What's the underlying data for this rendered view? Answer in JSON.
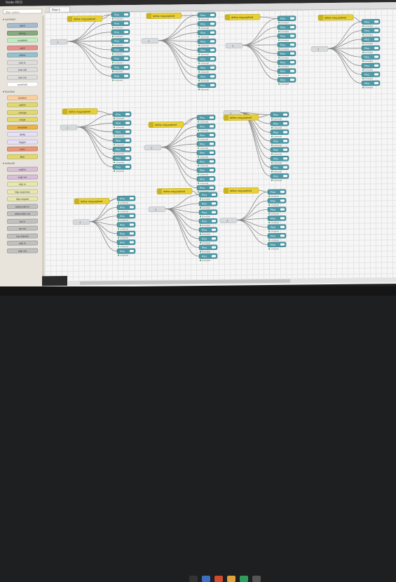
{
  "window": {
    "title": "Node-RED"
  },
  "palette": {
    "search_placeholder": "filter nodes",
    "categories": [
      "common",
      "function",
      "network"
    ],
    "nodes": [
      {
        "label": "inject",
        "color": "#a6bbcf"
      },
      {
        "label": "debug",
        "color": "#87a980"
      },
      {
        "label": "complete",
        "color": "#c0edc0"
      },
      {
        "label": "catch",
        "color": "#e49191"
      },
      {
        "label": "status",
        "color": "#94c1d0"
      },
      {
        "label": "link in",
        "color": "#dddddd"
      },
      {
        "label": "link call",
        "color": "#dddddd"
      },
      {
        "label": "link out",
        "color": "#dddddd"
      },
      {
        "label": "comment",
        "color": "#ffffff"
      },
      {
        "label": "function",
        "color": "#fdd0a2"
      },
      {
        "label": "switch",
        "color": "#e2d96e"
      },
      {
        "label": "change",
        "color": "#e2d96e"
      },
      {
        "label": "range",
        "color": "#e2d96e"
      },
      {
        "label": "template",
        "color": "#ebb44b"
      },
      {
        "label": "delay",
        "color": "#e6e0f8"
      },
      {
        "label": "trigger",
        "color": "#e6e0f8"
      },
      {
        "label": "exec",
        "color": "#e9967a"
      },
      {
        "label": "filter",
        "color": "#e2d96e"
      },
      {
        "label": "mqtt in",
        "color": "#d8bfd8"
      },
      {
        "label": "mqtt out",
        "color": "#d8bfd8"
      },
      {
        "label": "http in",
        "color": "#e7e7ae"
      },
      {
        "label": "http response",
        "color": "#e7e7ae"
      },
      {
        "label": "http request",
        "color": "#e7e7ae"
      },
      {
        "label": "websocket in",
        "color": "#c0c0c0"
      },
      {
        "label": "websocket out",
        "color": "#c0c0c0"
      },
      {
        "label": "tcp in",
        "color": "#c0c0c0"
      },
      {
        "label": "tcp out",
        "color": "#c0c0c0"
      },
      {
        "label": "tcp request",
        "color": "#c0c0c0"
      },
      {
        "label": "udp in",
        "color": "#c0c0c0"
      },
      {
        "label": "udp out",
        "color": "#c0c0c0"
      }
    ]
  },
  "workspace": {
    "tab_label": "Flow 1"
  },
  "flow": {
    "function_label": "define msg.payload",
    "output_label": "Pins",
    "status_label": "connected",
    "input_label": "1"
  },
  "colors": {
    "function_node": "#e8d032",
    "output_node": "#4f9aa8",
    "input_node": "#d6dadd",
    "wire": "#8a8a8a"
  }
}
